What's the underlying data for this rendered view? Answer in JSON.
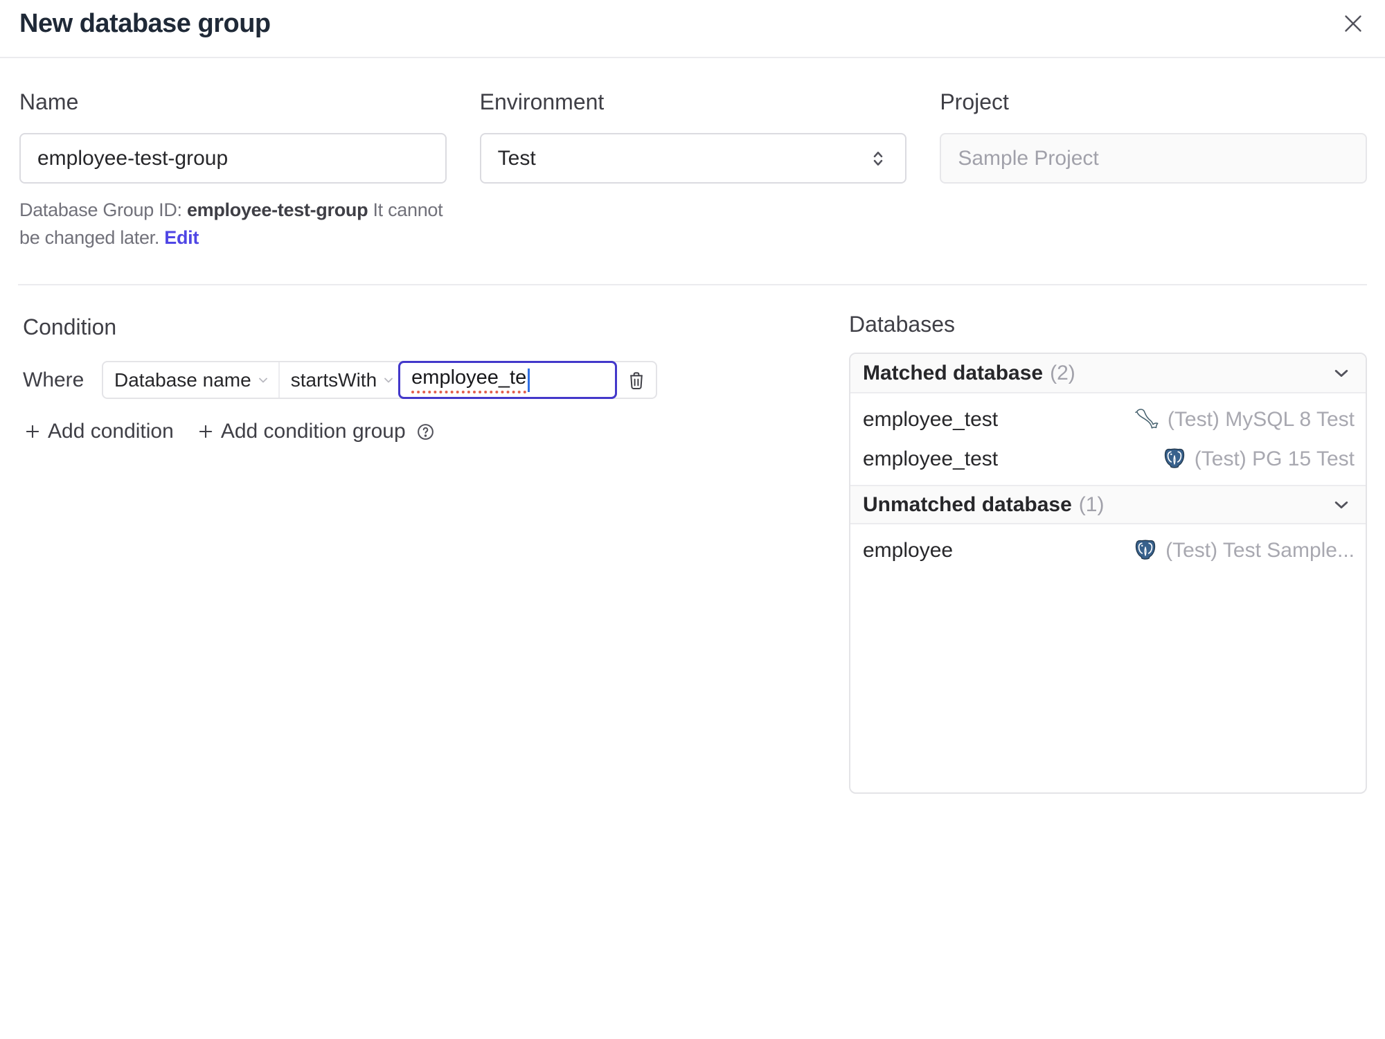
{
  "header": {
    "title": "New database group"
  },
  "form": {
    "name": {
      "label": "Name",
      "value": "employee-test-group"
    },
    "environment": {
      "label": "Environment",
      "value": "Test"
    },
    "project": {
      "label": "Project",
      "value": "Sample Project"
    },
    "group_id_note": {
      "prefix": "Database Group ID: ",
      "id": "employee-test-group",
      "line1_suffix": " It cannot",
      "line2": "be changed later. ",
      "edit_label": "Edit"
    }
  },
  "condition": {
    "heading": "Condition",
    "where_label": "Where",
    "field": "Database name",
    "operator": "startsWith",
    "value": "employee_te",
    "add_condition_label": "Add condition",
    "add_condition_group_label": "Add condition group"
  },
  "databases": {
    "heading": "Databases",
    "groups": [
      {
        "title": "Matched database",
        "count": "(2)",
        "rows": [
          {
            "name": "employee_test",
            "engine": "mysql",
            "instance": "(Test) MySQL 8 Test"
          },
          {
            "name": "employee_test",
            "engine": "postgres",
            "instance": "(Test) PG 15 Test"
          }
        ]
      },
      {
        "title": "Unmatched database",
        "count": "(1)",
        "rows": [
          {
            "name": "employee",
            "engine": "postgres",
            "instance": "(Test) Test Sample..."
          }
        ]
      }
    ]
  },
  "colors": {
    "accent": "#4f46e5",
    "focus_border": "#4338ca",
    "link": "#4f46e5"
  }
}
